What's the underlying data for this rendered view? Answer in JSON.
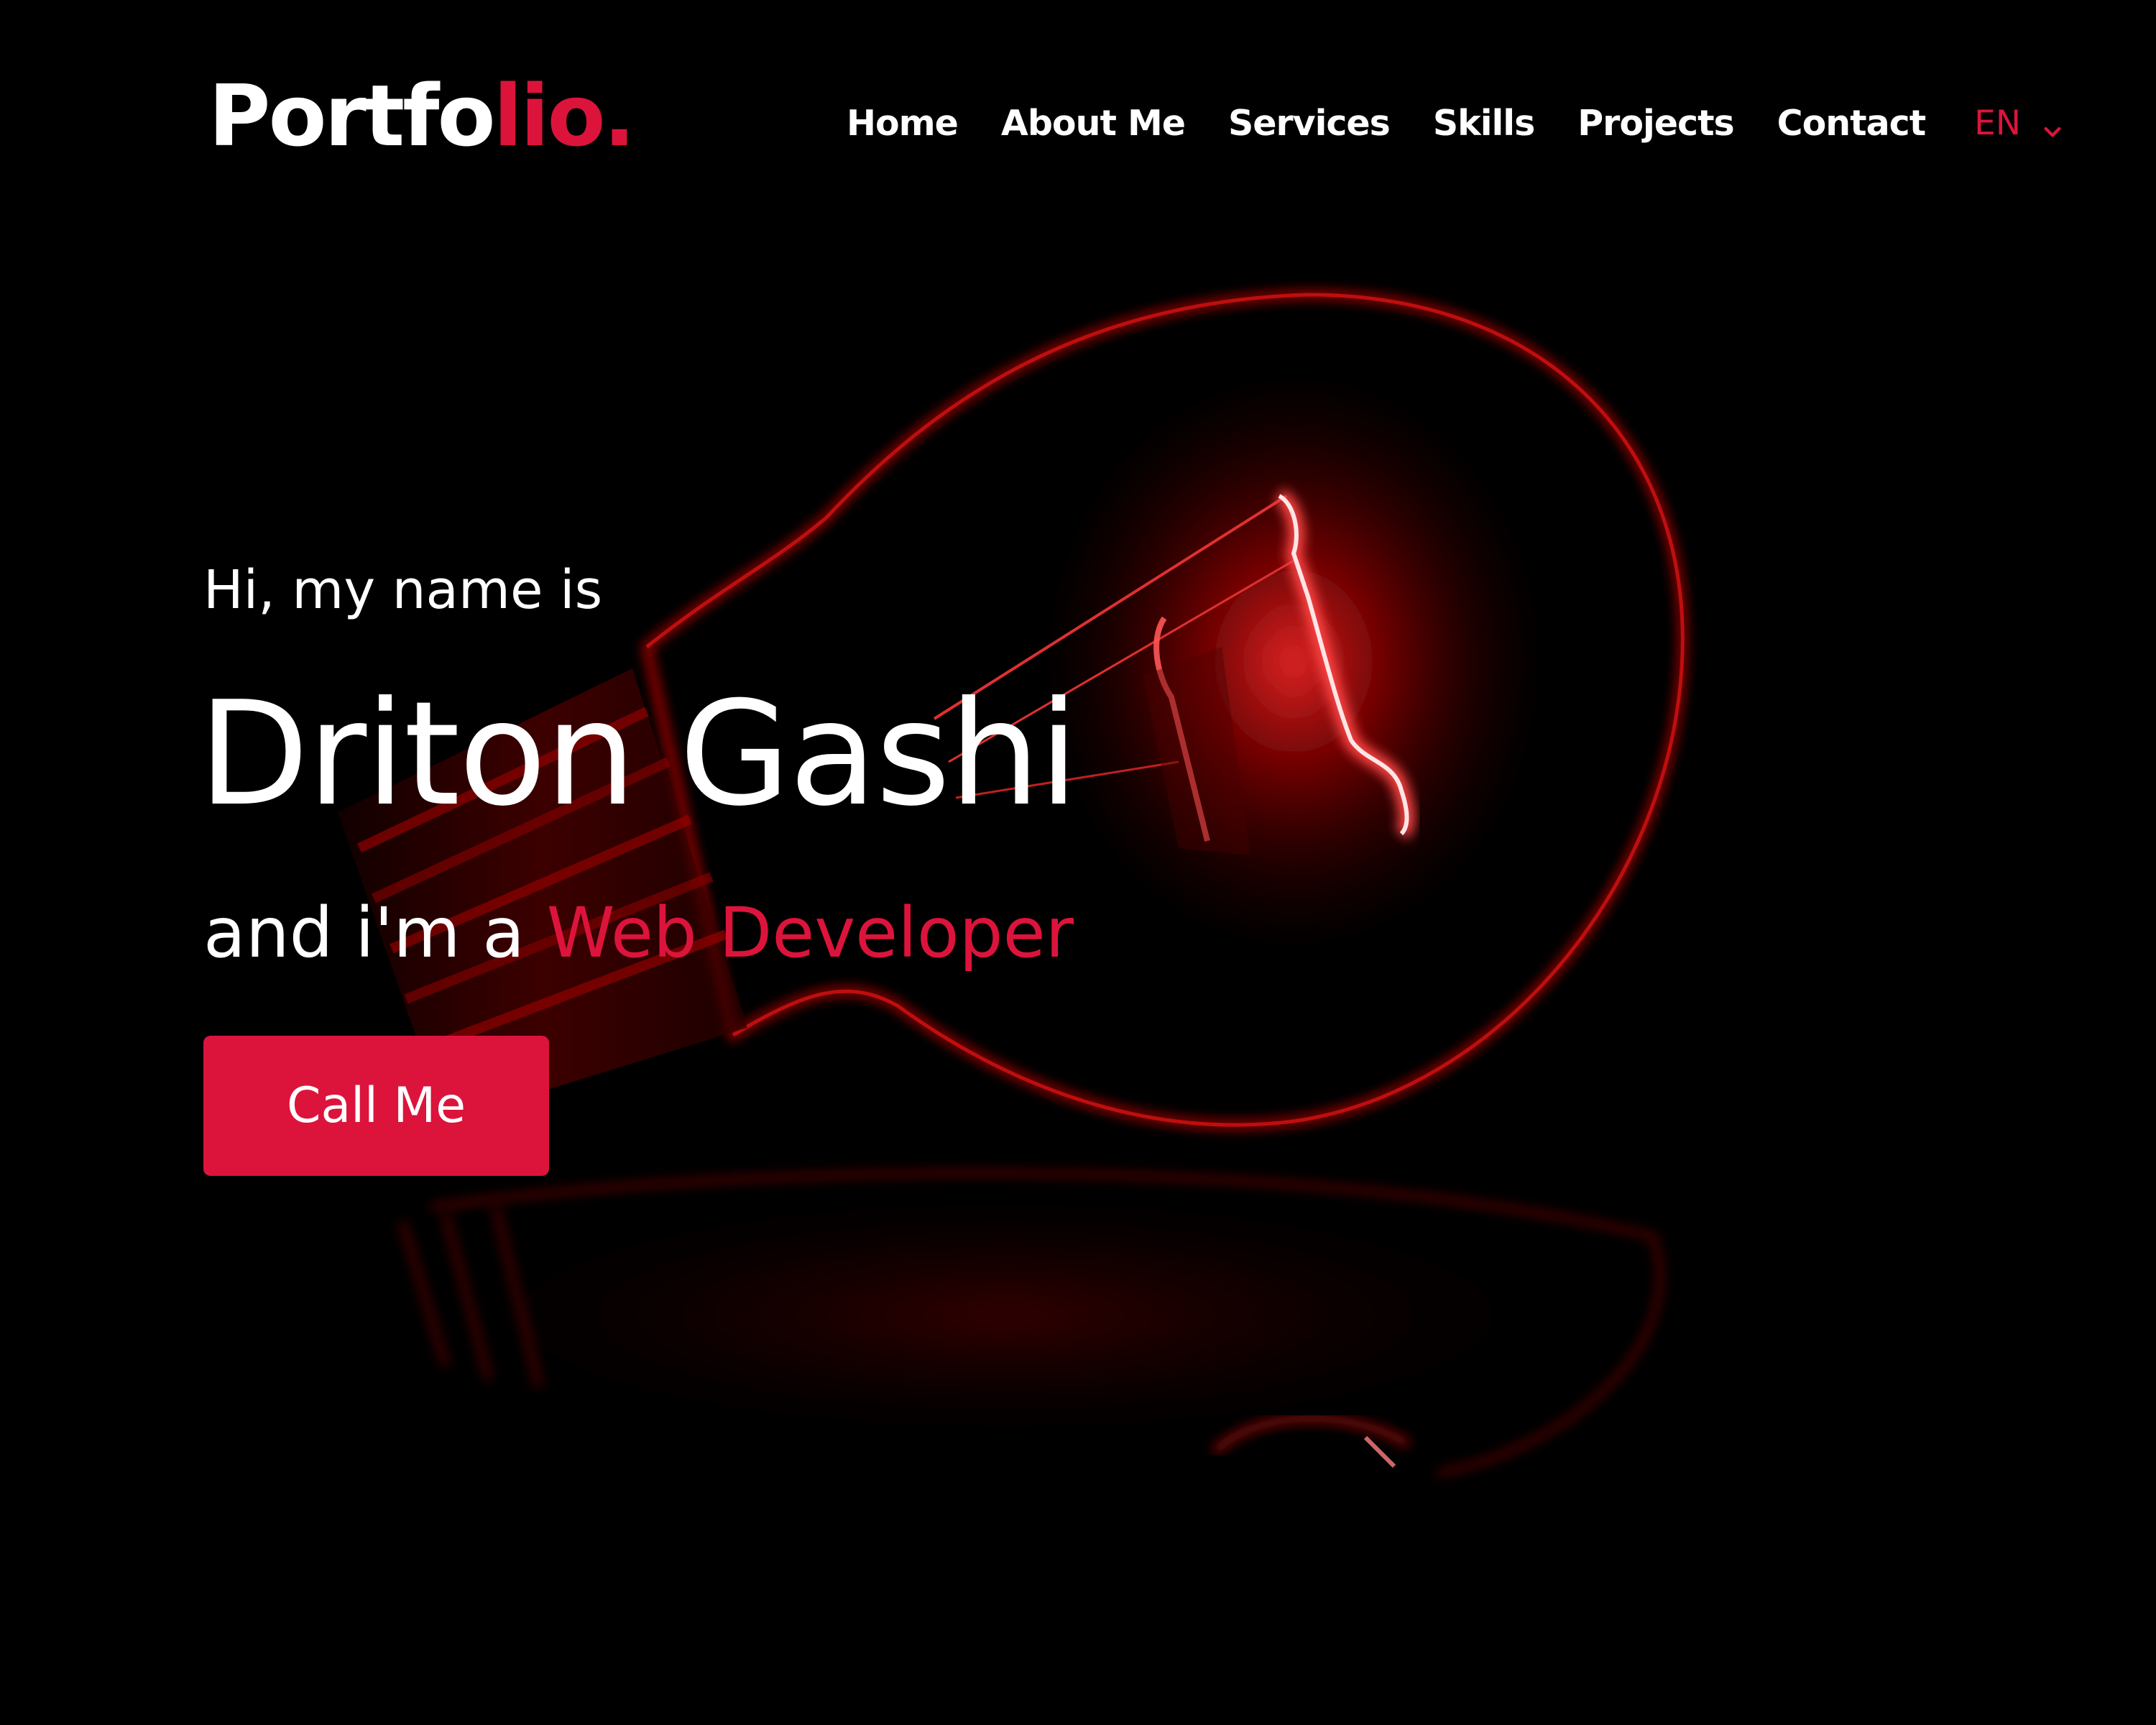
{
  "logo": {
    "main": "Portfo",
    "accent": "lio."
  },
  "nav": {
    "items": [
      "Home",
      "About Me",
      "Services",
      "Skills",
      "Projects",
      "Contact"
    ],
    "language": "EN",
    "language_icon": "chevron-down-icon"
  },
  "hero": {
    "greeting": "Hi, my name is",
    "name": "Driton Gashi",
    "role_prefix": "and i'm a ",
    "role": "Web Developer",
    "cta_label": "Call Me",
    "background_image": "red glowing light bulb on black background"
  },
  "colors": {
    "background": "#000000",
    "accent": "#dc143c",
    "text": "#ffffff"
  }
}
